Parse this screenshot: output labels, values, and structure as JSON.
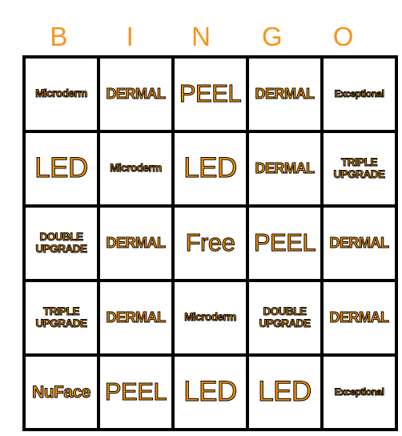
{
  "header": [
    "B",
    "I",
    "N",
    "G",
    "O"
  ],
  "rows": [
    [
      "Microderm",
      "DERMAL",
      "PEEL",
      "DERMAL",
      "Exceptional"
    ],
    [
      "LED",
      "Microderm",
      "LED",
      "DERMAL",
      "TRIPLE UPGRADE"
    ],
    [
      "DOUBLE UPGRADE",
      "DERMAL",
      "Free",
      "PEEL",
      "DERMAL"
    ],
    [
      "TRIPLE UPGRADE",
      "DERMAL",
      "Microderm",
      "DOUBLE UPGRADE",
      "DERMAL"
    ],
    [
      "NuFace",
      "PEEL",
      "LED",
      "LED",
      "Exceptional"
    ]
  ],
  "colors": {
    "accent": "#f7941d",
    "cell_text": "#ff9800",
    "grid": "#000000"
  }
}
